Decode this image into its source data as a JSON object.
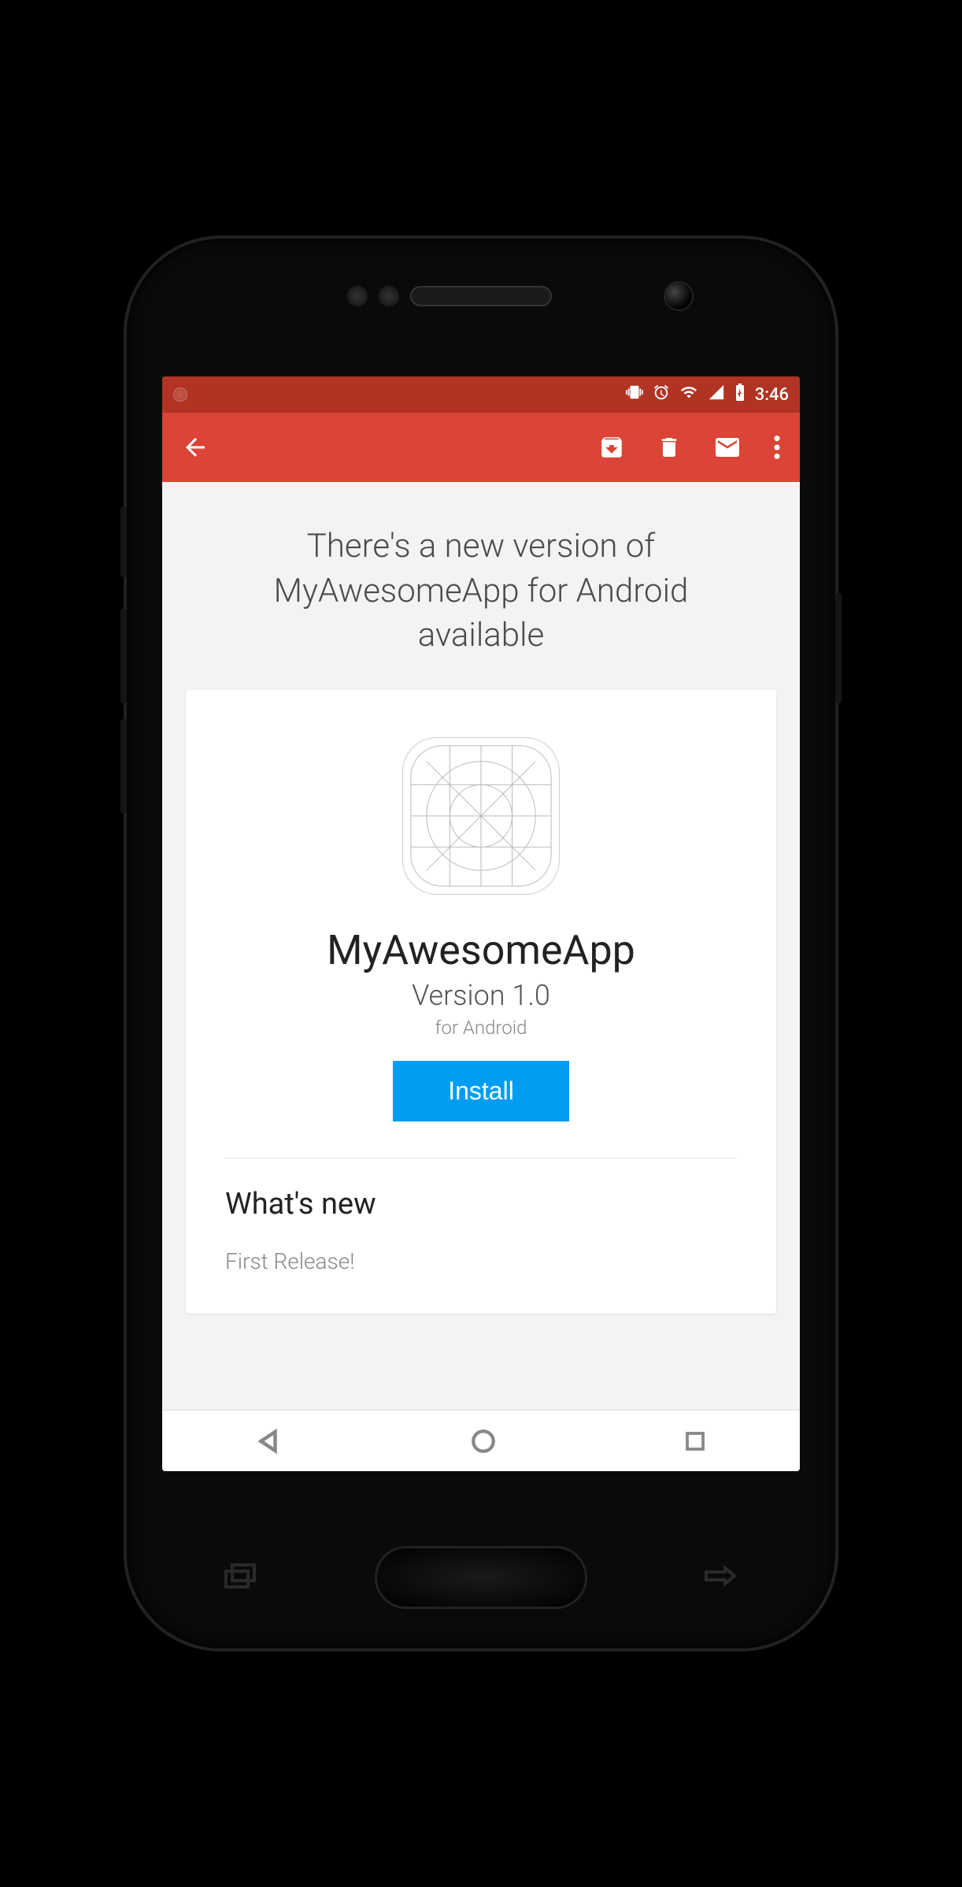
{
  "status": {
    "time": "3:46"
  },
  "email": {
    "subject": "There's a new version of MyAwesomeApp for Android available"
  },
  "app": {
    "name": "MyAwesomeApp",
    "version": "Version 1.0",
    "platform": "for Android",
    "install_label": "Install"
  },
  "whatsnew": {
    "title": "What's new",
    "body": "First Release!"
  },
  "colors": {
    "statusbar": "#b13324",
    "appbar": "#db4437",
    "install": "#009df0"
  }
}
